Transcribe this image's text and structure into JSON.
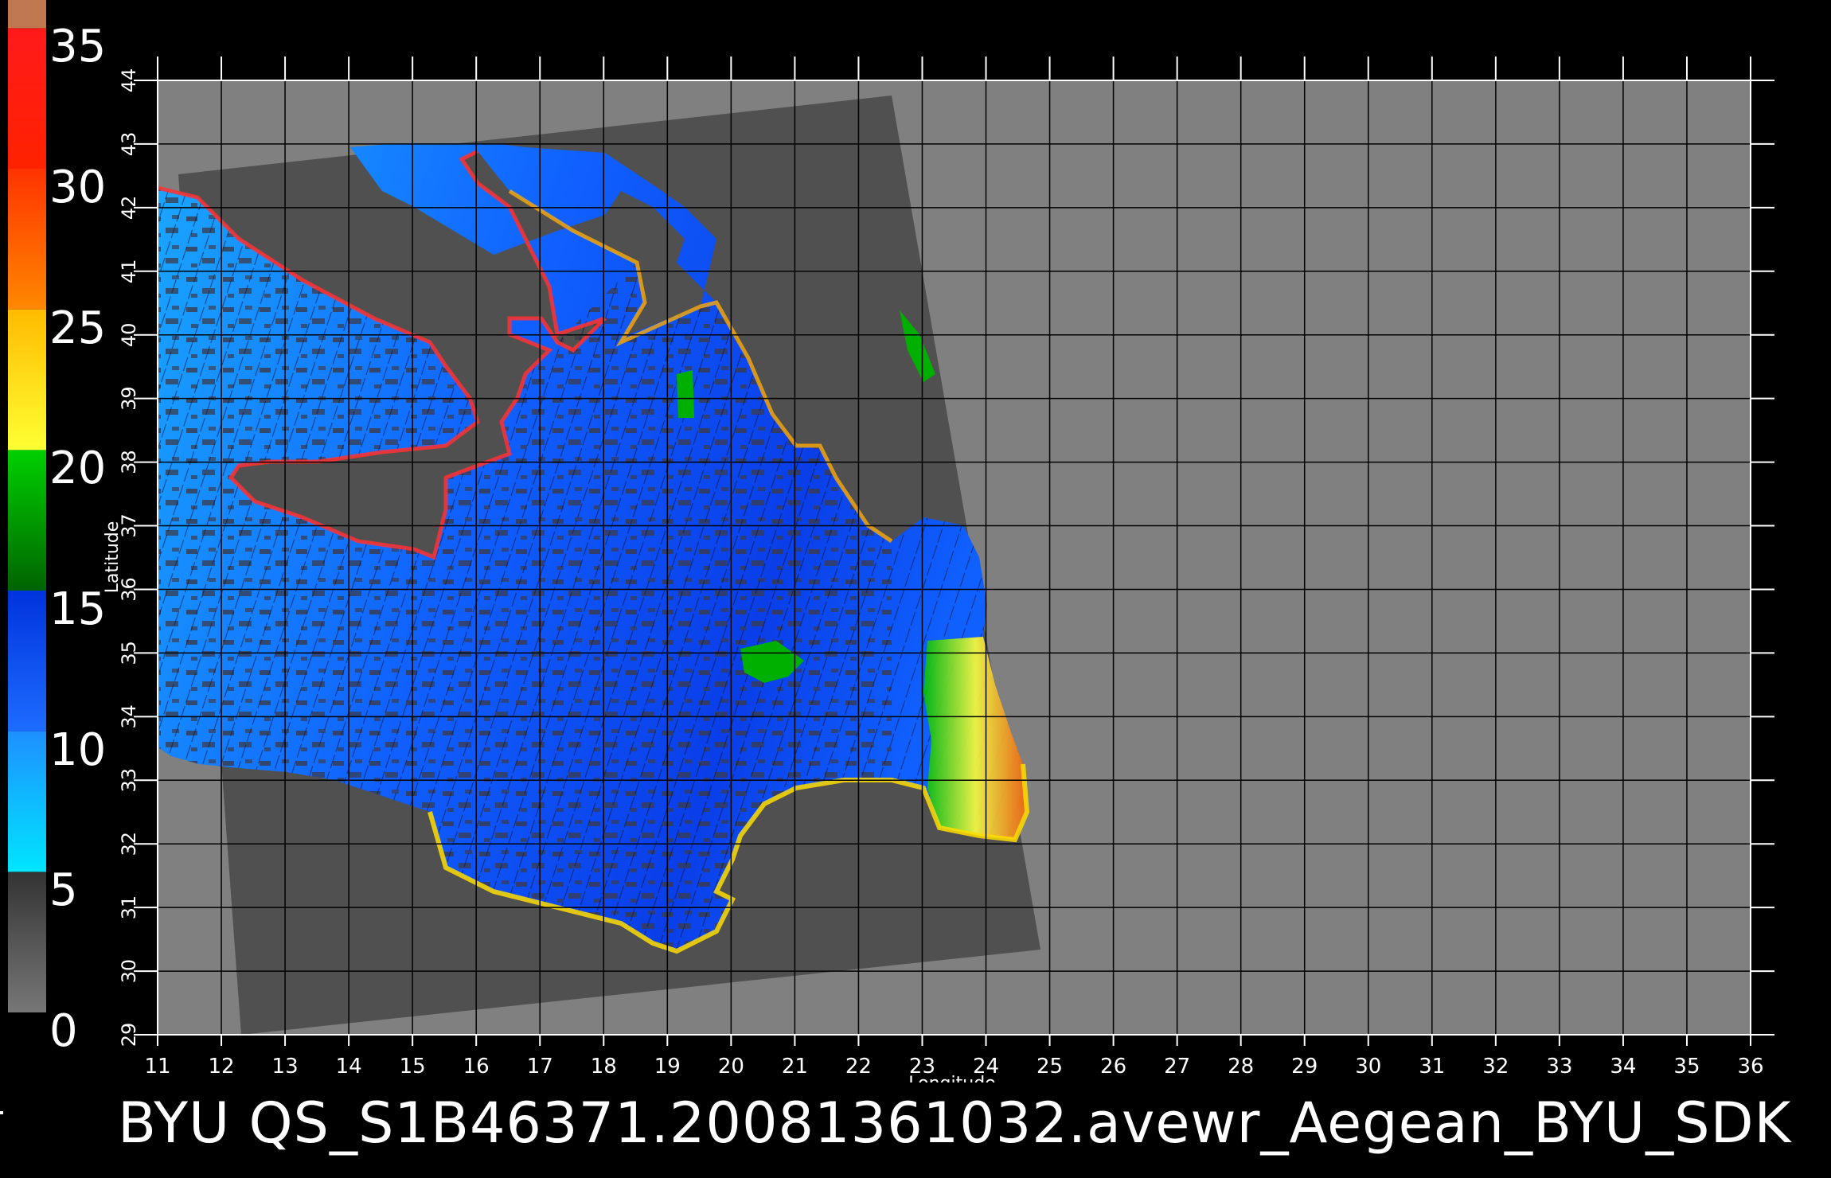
{
  "colorbar": {
    "labels": [
      "35",
      "30",
      "25",
      "20",
      "15",
      "10",
      "5",
      "0"
    ],
    "segments": [
      {
        "from": 0,
        "to": 5,
        "colors": [
          "#777777",
          "#333333"
        ]
      },
      {
        "from": 5,
        "to": 10,
        "colors": [
          "#00e5ff",
          "#1e90ff"
        ]
      },
      {
        "from": 10,
        "to": 15,
        "colors": [
          "#1e6cff",
          "#0033dd"
        ]
      },
      {
        "from": 15,
        "to": 20,
        "colors": [
          "#006400",
          "#00d000"
        ]
      },
      {
        "from": 20,
        "to": 25,
        "colors": [
          "#ffff33",
          "#ffbb00"
        ]
      },
      {
        "from": 25,
        "to": 30,
        "colors": [
          "#ff8800",
          "#ff3300"
        ]
      },
      {
        "from": 30,
        "to": 35,
        "colors": [
          "#ff2200",
          "#ff1a1a"
        ]
      },
      {
        "from": 35,
        "to": 36,
        "colors": [
          "#c07850",
          "#c07850"
        ]
      }
    ]
  },
  "map": {
    "xlabel": "Longitude",
    "ylabel": "Latitude",
    "lon_ticks": [
      "11",
      "12",
      "13",
      "14",
      "15",
      "16",
      "17",
      "18",
      "19",
      "20",
      "21",
      "22",
      "23",
      "24",
      "25",
      "26",
      "27",
      "28",
      "29",
      "30",
      "31",
      "32",
      "33",
      "34",
      "35",
      "36"
    ],
    "lat_ticks": [
      "29",
      "30",
      "31",
      "32",
      "33",
      "34",
      "35",
      "36",
      "37",
      "38",
      "39",
      "40",
      "41",
      "42",
      "43",
      "44"
    ],
    "colors": {
      "background": "#000000",
      "nodata": "#808080",
      "swath": "#505050",
      "grid": "#000000"
    }
  },
  "footer": {
    "title": "BYU  QS_S1B46371.20081361032.avewr_Aegean_BYU_SDK"
  }
}
